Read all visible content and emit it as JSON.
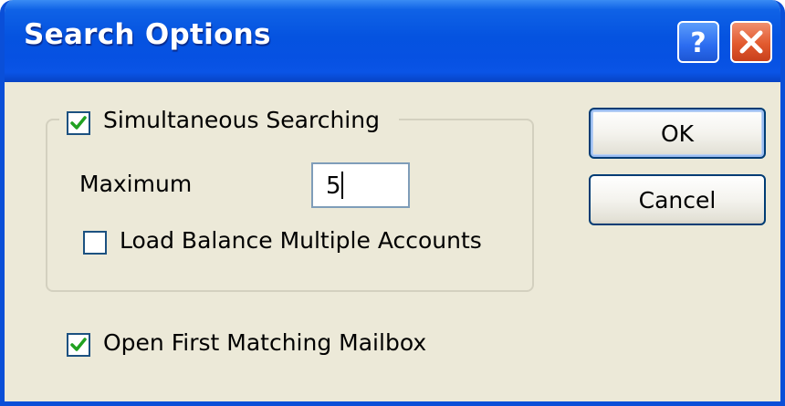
{
  "dialog": {
    "title": "Search Options",
    "help_button_glyph": "?",
    "close_button_icon": "close-icon"
  },
  "simultaneous": {
    "label": "Simultaneous Searching",
    "checked": true,
    "maximum_label": "Maximum",
    "maximum_value": "5",
    "load_balance_label": "Load Balance Multiple Accounts",
    "load_balance_checked": false
  },
  "open_first": {
    "label": "Open First Matching Mailbox",
    "checked": true
  },
  "buttons": {
    "ok_label": "OK",
    "cancel_label": "Cancel"
  },
  "colors": {
    "titlebar": "#0553e0",
    "face": "#ece9d8",
    "checkmark": "#21a121",
    "close": "#e25a2e"
  }
}
